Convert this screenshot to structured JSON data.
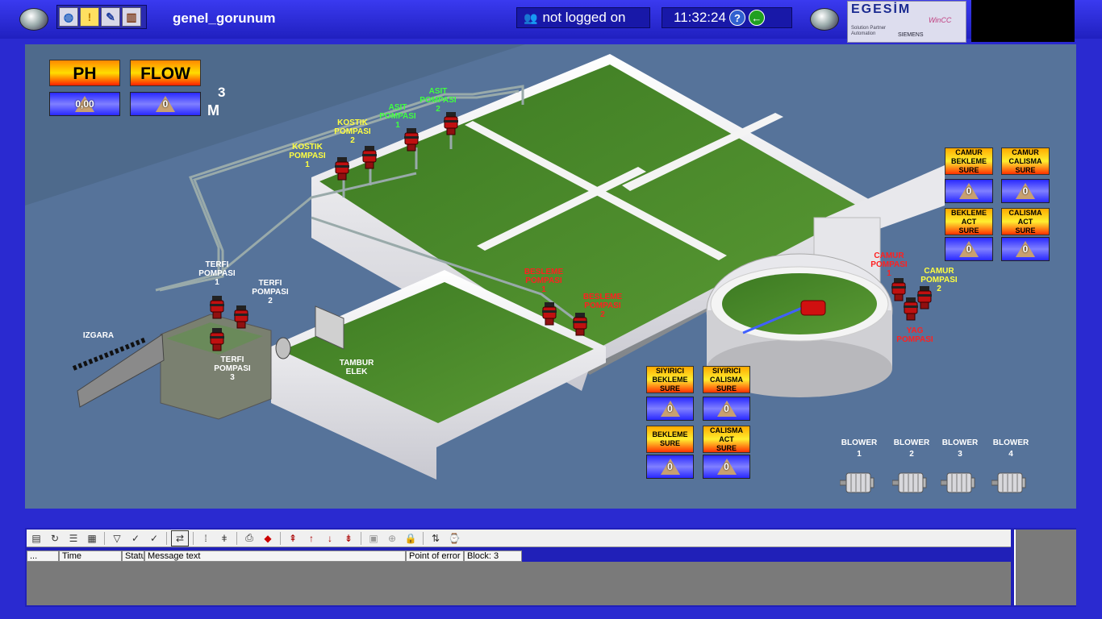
{
  "topbar": {
    "screen_name": "genel_gorunum",
    "user_status": "not logged on",
    "clock": "11:32:24",
    "logo_text": "EGESİM",
    "logo_sub": "Solution Partner Automation",
    "logo_siemens": "SIEMENS",
    "logo_wincc": "WinCC"
  },
  "measurements": {
    "ph": {
      "label": "PH",
      "value": "0,00"
    },
    "flow": {
      "label": "FLOW",
      "value": "0",
      "unit_sup": "3",
      "unit": "M"
    }
  },
  "plant_labels": {
    "kostik1": "KOSTIK\nPOMPASI\n1",
    "kostik2": "KOSTIK\nPOMPASI\n2",
    "asit1": "ASIT\nPOMPASI\n1",
    "asit2": "ASIT\nPOMPASI\n2",
    "terfi1": "TERFI\nPOMPASI\n1",
    "terfi2": "TERFI\nPOMPASI\n2",
    "terfi3": "TERFI\nPOMPASI\n3",
    "izgara": "IZGARA",
    "tambur": "TAMBUR\nELEK",
    "besleme1": "BESLEME\nPOMPASI\n1",
    "besleme2": "BESLEME\nPOMPASI\n2",
    "camur1": "CAMUR\nPOMPASI\n1",
    "camur2": "CAMUR\nPOMPASI\n2",
    "yag": "YAG\nPOMPASI"
  },
  "timers": {
    "camur_bekleme": {
      "label": "CAMUR\nBEKLEME\nSURE",
      "value": "0"
    },
    "camur_calisma": {
      "label": "CAMUR\nCALISMA\nSURE",
      "value": "0"
    },
    "bekleme_act": {
      "label": "BEKLEME\nACT\nSURE",
      "value": "0"
    },
    "calisma_act": {
      "label": "CALISMA\nACT\nSURE",
      "value": "0"
    },
    "siyirici_bekleme": {
      "label": "SIYIRICI\nBEKLEME\nSURE",
      "value": "0"
    },
    "siyirici_calisma": {
      "label": "SIYIRICI\nCALISMA\nSURE",
      "value": "0"
    },
    "bekleme": {
      "label": "BEKLEME\nSURE",
      "value": "0"
    },
    "calisma_act2": {
      "label": "CALISMA\nACT\nSURE",
      "value": "0"
    }
  },
  "blowers": [
    "BLOWER\n1",
    "BLOWER\n2",
    "BLOWER\n3",
    "BLOWER\n4"
  ],
  "alarm": {
    "columns": [
      "...",
      "Time",
      "Statu",
      "Message text",
      "Point of error",
      "Block:  3"
    ]
  },
  "colors": {
    "frame": "#2a2ad0",
    "background": "#4e6a8c",
    "water": "#4a8a2a",
    "pump": "#c01010"
  }
}
